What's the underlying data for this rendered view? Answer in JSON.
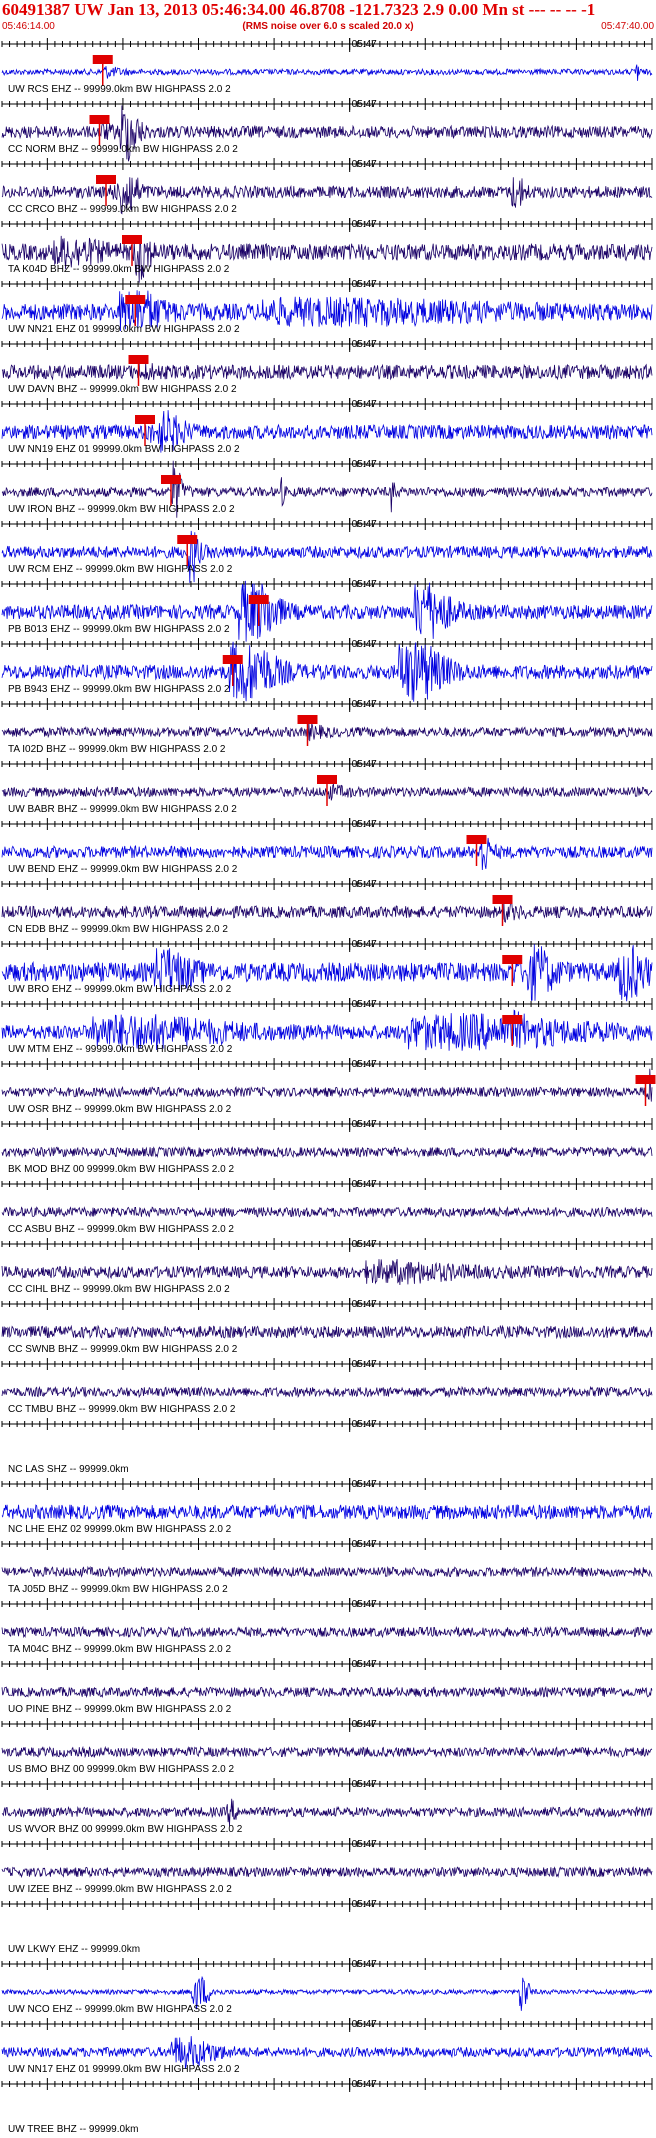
{
  "header": {
    "title": "60491387 UW Jan 13, 2013 05:46:34.00   46.8708 -121.7323  2.9 0.00 Mn st --- -- --  -1",
    "subtitle": "(RMS noise over 6.0 s scaled 20.0 x)",
    "time_start": "05:46:14.00",
    "time_end": "05:47:40.00"
  },
  "colors": {
    "header_text": "#e00000",
    "trace_blue": "#0000e0",
    "trace_dark": "#1a0066",
    "pick": "#e00000",
    "axis": "#000000"
  },
  "chart_data": {
    "type": "line",
    "x_axis": {
      "start": "05:46:14.00",
      "end": "05:47:40.00",
      "mid_label": "05:47"
    },
    "traces": [
      {
        "label": "UW RCS EHZ -- 99999.0km BW  HIGHPASS  2.0  2",
        "color": "blue",
        "amp": 0.12,
        "pick": 0.155,
        "bursts": [
          [
            0.975,
            0.004,
            1.0
          ]
        ]
      },
      {
        "label": "CC NORM BHZ -- 99999.0km BW  HIGHPASS  2.0  2",
        "color": "dark",
        "amp": 0.25,
        "pick": 0.15,
        "bursts": [
          [
            0.19,
            0.02,
            1.1
          ]
        ]
      },
      {
        "label": "CC CRCO BHZ -- 99999.0km BW  HIGHPASS  2.0  2",
        "color": "dark",
        "amp": 0.25,
        "pick": 0.16,
        "bursts": [
          [
            0.19,
            0.02,
            0.9
          ],
          [
            0.79,
            0.015,
            0.55
          ]
        ]
      },
      {
        "label": "TA K04D BHZ -- 99999.0km BW  HIGHPASS  2.0  2",
        "color": "dark",
        "amp": 0.35,
        "pick": 0.2,
        "bursts": [
          [
            0.1,
            0.05,
            0.4
          ],
          [
            0.21,
            0.015,
            1.1
          ]
        ]
      },
      {
        "label": "UW NN21 EHZ 01 99999.0km BW  HIGHPASS  2.0  2",
        "color": "blue",
        "amp": 0.35,
        "pick": 0.205,
        "bursts": [
          [
            0.2,
            0.05,
            0.6
          ],
          [
            0.5,
            0.25,
            0.3
          ]
        ]
      },
      {
        "label": "UW DAVN BHZ -- 99999.0km BW  HIGHPASS  2.0  2",
        "color": "dark",
        "amp": 0.3,
        "pick": 0.21,
        "bursts": []
      },
      {
        "label": "UW NN19 EHZ 01 99999.0km BW  HIGHPASS  2.0  2",
        "color": "blue",
        "amp": 0.3,
        "pick": 0.22,
        "bursts": [
          [
            0.25,
            0.03,
            0.6
          ]
        ]
      },
      {
        "label": "UW IRON BHZ -- 99999.0km BW  HIGHPASS  2.0  2",
        "color": "dark",
        "amp": 0.2,
        "pick": 0.26,
        "bursts": [
          [
            0.265,
            0.01,
            1.0
          ],
          [
            0.43,
            0.004,
            0.5
          ],
          [
            0.6,
            0.004,
            0.7
          ]
        ]
      },
      {
        "label": "UW RCM EHZ -- 99999.0km BW  HIGHPASS  2.0  2",
        "color": "blue",
        "amp": 0.25,
        "pick": 0.285,
        "bursts": [
          [
            0.29,
            0.01,
            1.2
          ]
        ]
      },
      {
        "label": "PB B013 EHZ -- 99999.0km BW  HIGHPASS  2.0  2",
        "color": "blue",
        "amp": 0.3,
        "pick": 0.395,
        "bursts": [
          [
            0.38,
            0.04,
            1.2
          ],
          [
            0.65,
            0.04,
            1.0
          ]
        ]
      },
      {
        "label": "PB B943 EHZ -- 99999.0km BW  HIGHPASS  2.0  2",
        "color": "blue",
        "amp": 0.3,
        "pick": 0.355,
        "bursts": [
          [
            0.37,
            0.05,
            1.2
          ],
          [
            0.63,
            0.05,
            1.2
          ]
        ]
      },
      {
        "label": "TA I02D BHZ -- 99999.0km BW  HIGHPASS  2.0  2",
        "color": "dark",
        "amp": 0.2,
        "pick": 0.47,
        "bursts": []
      },
      {
        "label": "UW BABR BHZ -- 99999.0km BW  HIGHPASS  2.0  2",
        "color": "dark",
        "amp": 0.2,
        "pick": 0.5,
        "bursts": []
      },
      {
        "label": "UW BEND EHZ -- 99999.0km BW  HIGHPASS  2.0  2",
        "color": "blue",
        "amp": 0.25,
        "pick": 0.73,
        "bursts": [
          [
            0.74,
            0.008,
            0.8
          ]
        ]
      },
      {
        "label": "CN EDB BHZ -- 99999.0km BW  HIGHPASS  2.0  2",
        "color": "dark",
        "amp": 0.25,
        "pick": 0.77,
        "bursts": []
      },
      {
        "label": "UW BRO EHZ -- 99999.0km BW  HIGHPASS  2.0  2",
        "color": "blue",
        "amp": 0.4,
        "pick": 0.785,
        "bursts": [
          [
            0.25,
            0.04,
            0.7
          ],
          [
            0.82,
            0.03,
            0.8
          ],
          [
            0.96,
            0.03,
            0.9
          ]
        ]
      },
      {
        "label": "UW MTM EHZ -- 99999.0km BW  HIGHPASS  2.0  2",
        "color": "blue",
        "amp": 0.3,
        "pick": 0.785,
        "bursts": [
          [
            0.2,
            0.15,
            0.5
          ],
          [
            0.7,
            0.2,
            0.5
          ]
        ]
      },
      {
        "label": "UW OSR BHZ -- 99999.0km BW  HIGHPASS  2.0  2",
        "color": "dark",
        "amp": 0.2,
        "pick": 0.99,
        "bursts": [
          [
            0.995,
            0.004,
            1.0
          ]
        ]
      },
      {
        "label": "BK MOD BHZ 00 99999.0km BW  HIGHPASS  2.0  2",
        "color": "dark",
        "amp": 0.2,
        "pick": null,
        "bursts": []
      },
      {
        "label": "CC ASBU BHZ -- 99999.0km BW  HIGHPASS  2.0  2",
        "color": "dark",
        "amp": 0.2,
        "pick": null,
        "bursts": []
      },
      {
        "label": "CC CIHL BHZ -- 99999.0km BW  HIGHPASS  2.0  2",
        "color": "dark",
        "amp": 0.25,
        "pick": null,
        "bursts": [
          [
            0.6,
            0.1,
            0.3
          ]
        ]
      },
      {
        "label": "CC SWNB BHZ -- 99999.0km BW  HIGHPASS  2.0  2",
        "color": "dark",
        "amp": 0.25,
        "pick": null,
        "bursts": []
      },
      {
        "label": "CC TMBU BHZ -- 99999.0km BW  HIGHPASS  2.0  2",
        "color": "dark",
        "amp": 0.2,
        "pick": null,
        "bursts": []
      },
      {
        "label": "NC LAS SHZ -- 99999.0km",
        "color": "blue",
        "amp": 0.0,
        "pick": null,
        "bursts": []
      },
      {
        "label": "NC LHE EHZ 02 99999.0km BW  HIGHPASS  2.0  2",
        "color": "blue",
        "amp": 0.3,
        "pick": null,
        "bursts": []
      },
      {
        "label": "TA J05D BHZ -- 99999.0km BW  HIGHPASS  2.0  2",
        "color": "dark",
        "amp": 0.2,
        "pick": null,
        "bursts": []
      },
      {
        "label": "TA M04C BHZ -- 99999.0km BW  HIGHPASS  2.0  2",
        "color": "dark",
        "amp": 0.2,
        "pick": null,
        "bursts": []
      },
      {
        "label": "UO PINE BHZ -- 99999.0km BW  HIGHPASS  2.0  2",
        "color": "dark",
        "amp": 0.2,
        "pick": null,
        "bursts": []
      },
      {
        "label": "US BMO BHZ 00 99999.0km BW  HIGHPASS  2.0  2",
        "color": "dark",
        "amp": 0.2,
        "pick": null,
        "bursts": []
      },
      {
        "label": "US WVOR BHZ 00 99999.0km BW  HIGHPASS  2.0  2",
        "color": "dark",
        "amp": 0.2,
        "pick": null,
        "bursts": [
          [
            0.35,
            0.01,
            0.4
          ]
        ]
      },
      {
        "label": "UW IZEE BHZ -- 99999.0km BW  HIGHPASS  2.0  2",
        "color": "dark",
        "amp": 0.2,
        "pick": null,
        "bursts": []
      },
      {
        "label": "UW LKWY EHZ -- 99999.0km",
        "color": "blue",
        "amp": 0.0,
        "pick": null,
        "bursts": []
      },
      {
        "label": "UW NCO EHZ -- 99999.0km BW  HIGHPASS  2.0  2",
        "color": "blue",
        "amp": 0.1,
        "pick": null,
        "bursts": [
          [
            0.3,
            0.02,
            0.7
          ],
          [
            0.8,
            0.01,
            0.9
          ]
        ]
      },
      {
        "label": "UW NN17 EHZ 01 99999.0km BW  HIGHPASS  2.0  2",
        "color": "blue",
        "amp": 0.2,
        "pick": null,
        "bursts": [
          [
            0.28,
            0.05,
            0.5
          ]
        ]
      },
      {
        "label": "UW TREE BHZ -- 99999.0km",
        "color": "blue",
        "amp": 0.0,
        "pick": null,
        "bursts": []
      }
    ]
  }
}
